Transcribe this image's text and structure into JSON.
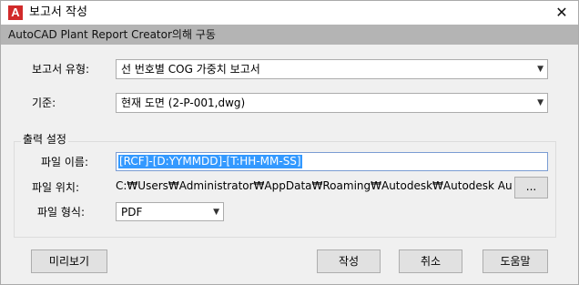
{
  "window": {
    "title": "보고서 작성",
    "icon_letter": "A",
    "close_glyph": "✕"
  },
  "banner": {
    "text": "AutoCAD Plant Report Creator의해 구동"
  },
  "report_type": {
    "label": "보고서 유형:",
    "value": "선 번호별 COG 가중치 보고서"
  },
  "criteria": {
    "label": "기준:",
    "value": "현재 도면 (2-P-001,dwg)"
  },
  "output_settings": {
    "title": "출력 설정",
    "file_name": {
      "label": "파일 이름:",
      "value": "[RCF]-[D:YYMMDD]-[T:HH-MM-SS]"
    },
    "file_location": {
      "label": "파일 위치:",
      "value": "C:₩Users₩Administrator₩AppData₩Roaming₩Autodesk₩Autodesk AutoCAD",
      "browse_label": "..."
    },
    "file_format": {
      "label": "파일 형식:",
      "value": "PDF"
    }
  },
  "buttons": {
    "preview": "미리보기",
    "create": "작성",
    "cancel": "취소",
    "help": "도움말"
  },
  "icons": {
    "dropdown_arrow": "▼"
  }
}
